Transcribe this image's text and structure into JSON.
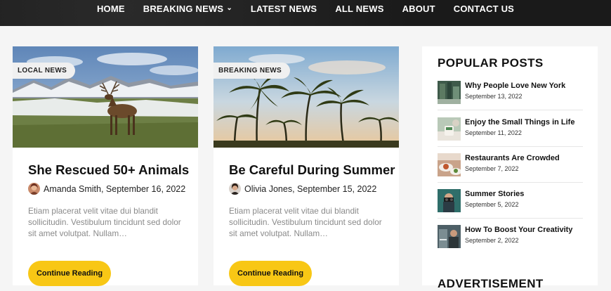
{
  "nav": {
    "items": [
      {
        "label": "HOME"
      },
      {
        "label": "BREAKING NEWS"
      },
      {
        "label": "LATEST NEWS"
      },
      {
        "label": "ALL NEWS"
      },
      {
        "label": "ABOUT"
      },
      {
        "label": "CONTACT US"
      }
    ],
    "dropdown_icon": "chevron-down-icon"
  },
  "cards": [
    {
      "badge": "LOCAL NEWS",
      "title": "She Rescued 50+ Animals",
      "meta": "Amanda Smith, September 16, 2022",
      "excerpt": "Etiam placerat velit vitae dui blandit sollicitudin. Vestibulum tincidunt sed dolor sit amet volutpat. Nullam…",
      "button": "Continue Reading"
    },
    {
      "badge": "BREAKING NEWS",
      "title": "Be Careful During Summer",
      "meta": "Olivia Jones, September 15, 2022",
      "excerpt": "Etiam placerat velit vitae dui blandit sollicitudin. Vestibulum tincidunt sed dolor sit amet volutpat. Nullam…",
      "button": "Continue Reading"
    }
  ],
  "sidebar": {
    "title": "POPULAR POSTS",
    "posts": [
      {
        "title": "Why People Love New York",
        "date": "September 13, 2022"
      },
      {
        "title": "Enjoy the Small Things in Life",
        "date": "September 11, 2022"
      },
      {
        "title": "Restaurants Are Crowded",
        "date": "September 7, 2022"
      },
      {
        "title": "Summer Stories",
        "date": "September 5, 2022"
      },
      {
        "title": "How To Boost Your Creativity",
        "date": "September 2, 2022"
      }
    ],
    "ad_title": "ADVERTISEMENT"
  },
  "colors": {
    "accent": "#f8c715",
    "nav_bg": "#1c1c1c"
  }
}
